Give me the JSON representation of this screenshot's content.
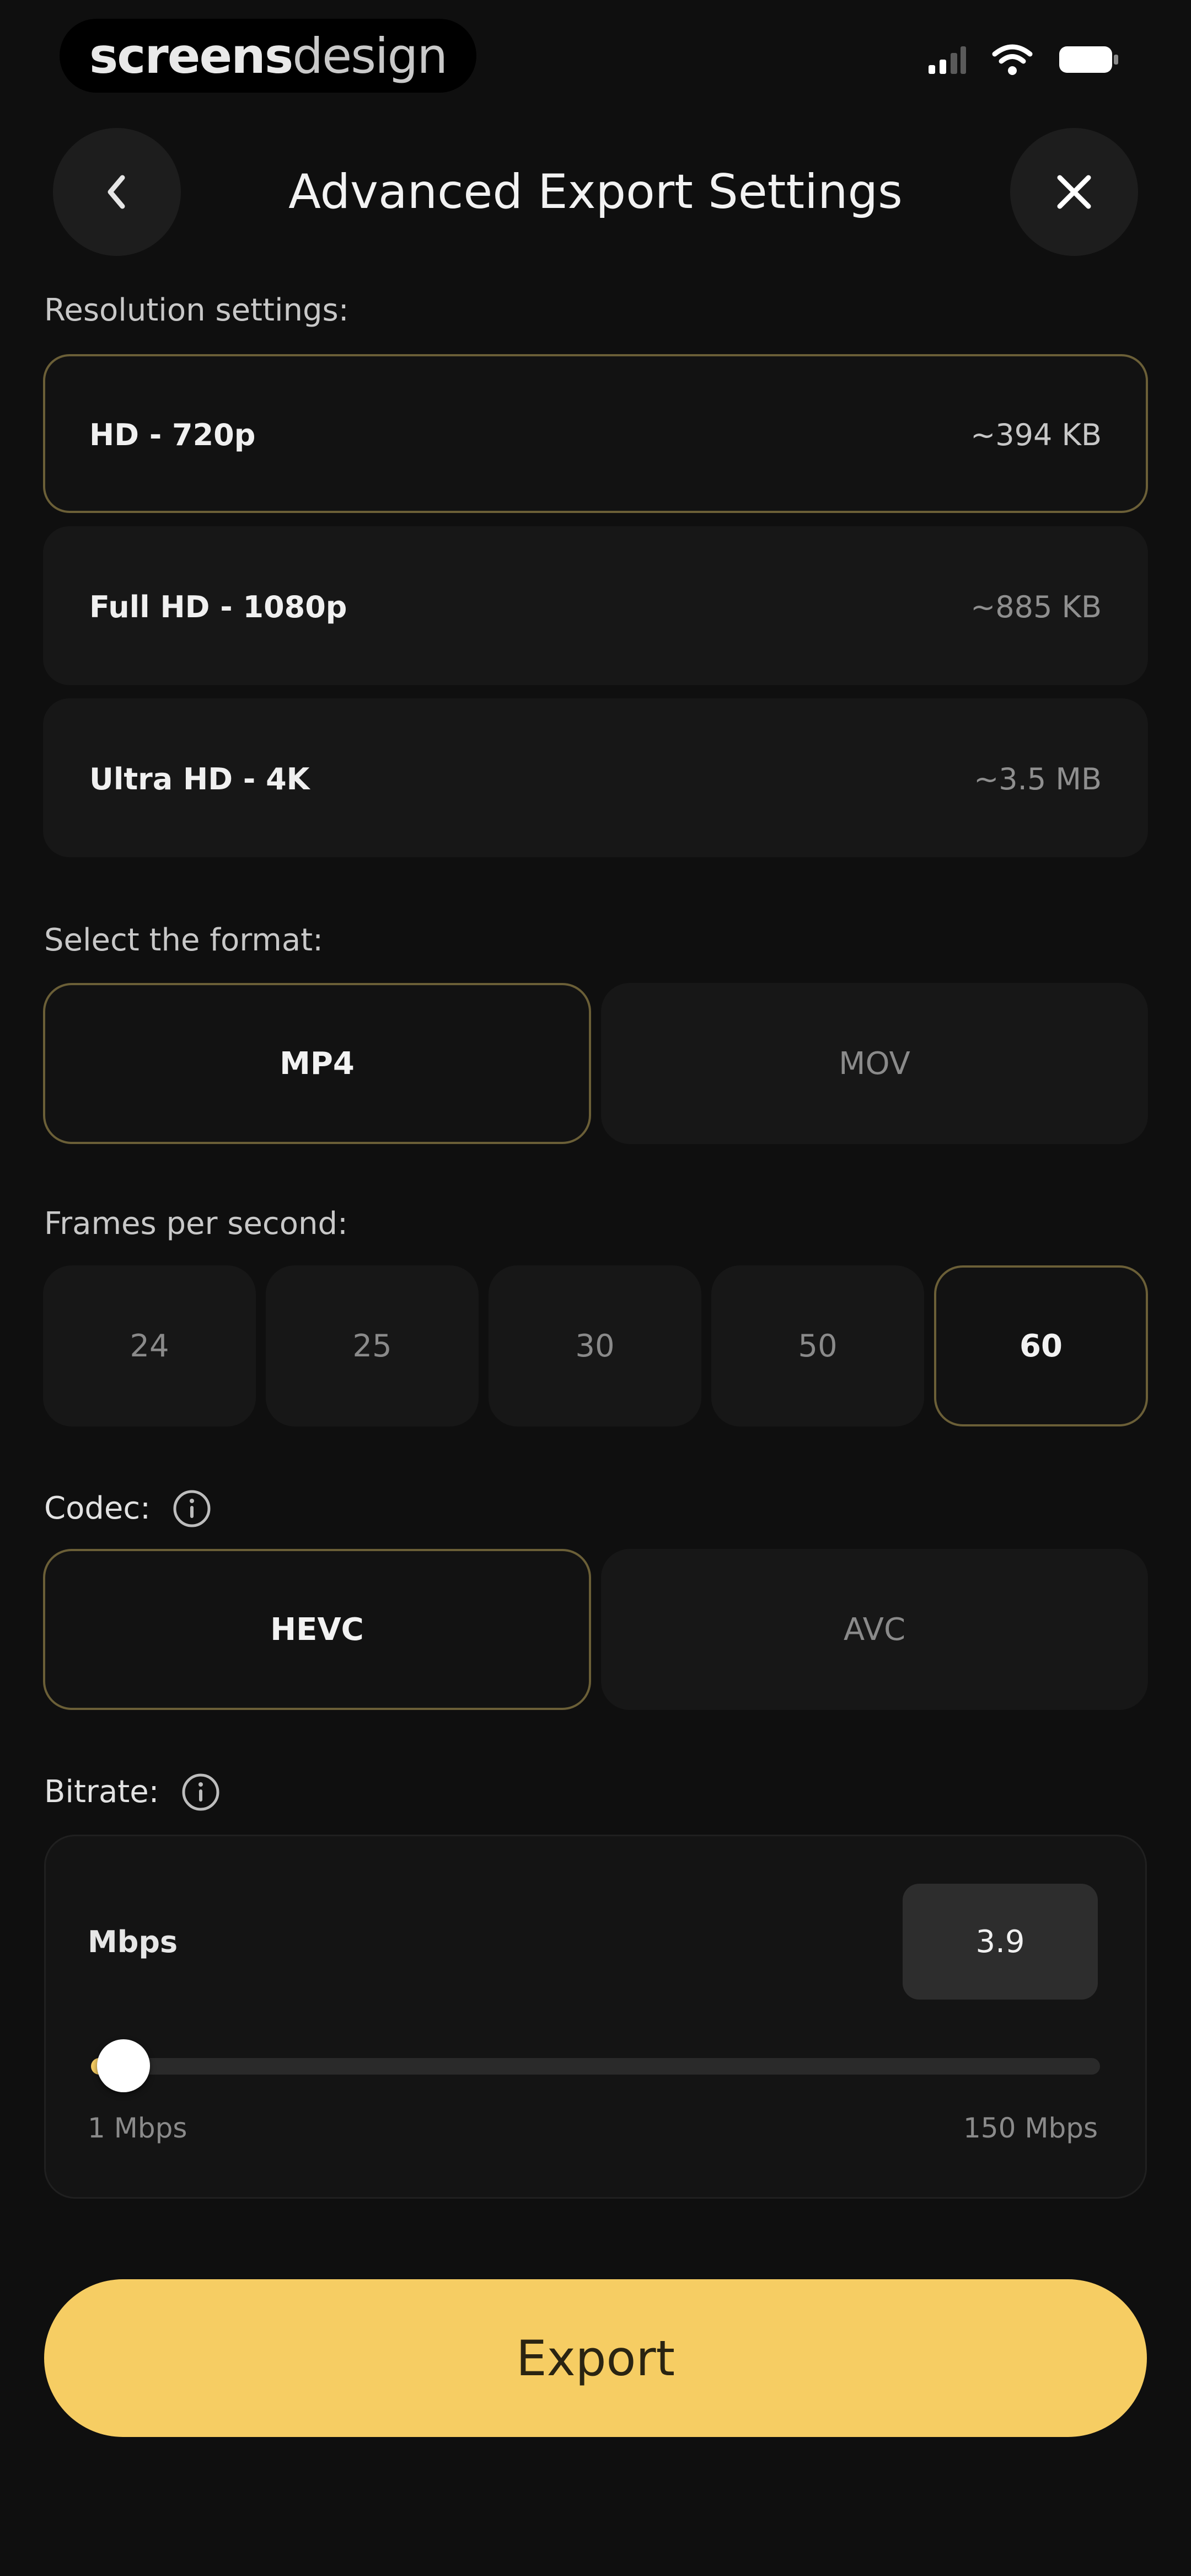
{
  "status_bar": {
    "brand_strong": "screens",
    "brand_light": "design"
  },
  "header": {
    "title": "Advanced Export Settings",
    "back_icon": "chevron-left-icon",
    "close_icon": "close-icon"
  },
  "resolution": {
    "label": "Resolution settings:",
    "options": [
      {
        "name": "HD - 720p",
        "size": "~394 KB",
        "selected": true
      },
      {
        "name": "Full HD - 1080p",
        "size": "~885 KB",
        "selected": false
      },
      {
        "name": "Ultra HD - 4K",
        "size": "~3.5 MB",
        "selected": false
      }
    ]
  },
  "format": {
    "label": "Select the format:",
    "options": [
      {
        "label": "MP4",
        "selected": true
      },
      {
        "label": "MOV",
        "selected": false
      }
    ]
  },
  "fps": {
    "label": "Frames per second:",
    "options": [
      {
        "label": "24",
        "selected": false
      },
      {
        "label": "25",
        "selected": false
      },
      {
        "label": "30",
        "selected": false
      },
      {
        "label": "50",
        "selected": false
      },
      {
        "label": "60",
        "selected": true
      }
    ]
  },
  "codec": {
    "label": "Codec:",
    "info_icon": "info-icon",
    "options": [
      {
        "label": "HEVC",
        "selected": true
      },
      {
        "label": "AVC",
        "selected": false
      }
    ]
  },
  "bitrate": {
    "label": "Bitrate:",
    "info_icon": "info-icon",
    "unit_label": "Mbps",
    "value": "3.9",
    "min_label": "1 Mbps",
    "max_label": "150 Mbps",
    "min": 1,
    "max": 150,
    "current": 3.9
  },
  "export": {
    "label": "Export"
  },
  "colors": {
    "background": "#0f0f0f",
    "card": "#171717",
    "accent": "#f6cd63",
    "selected_border": "#6b5f37"
  }
}
